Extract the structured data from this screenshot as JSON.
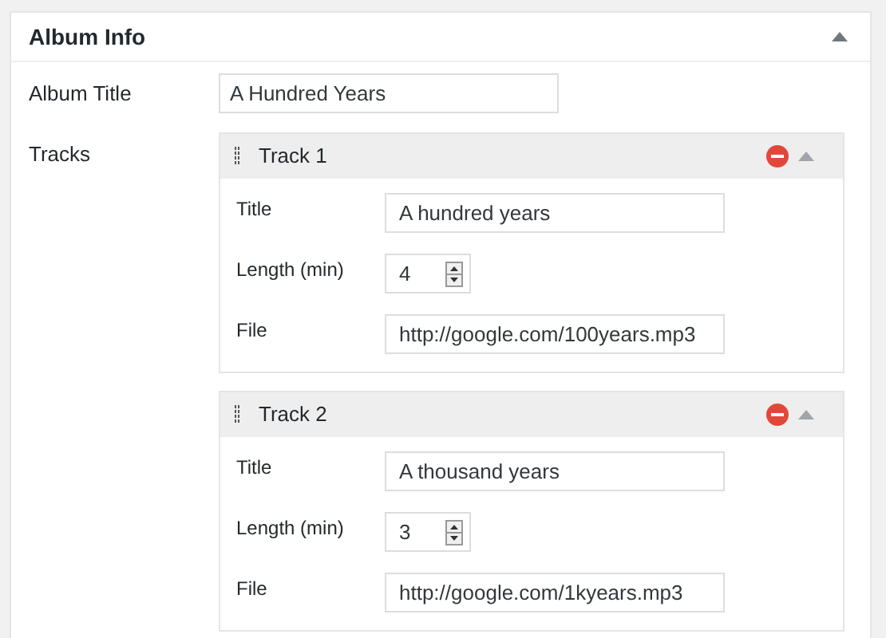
{
  "panel": {
    "title": "Album Info",
    "expanded": true
  },
  "album_title": {
    "label": "Album Title",
    "value": "A Hundred Years"
  },
  "tracks": {
    "label": "Tracks",
    "items": [
      {
        "title": "Track 1",
        "expanded": true,
        "fields": [
          {
            "kind": "text",
            "label": "Title",
            "value": "A hundred years"
          },
          {
            "kind": "number",
            "label": "Length (min)",
            "value": "4"
          },
          {
            "kind": "text",
            "label": "File",
            "value": "http://google.com/100years.mp3"
          }
        ]
      },
      {
        "title": "Track 2",
        "expanded": true,
        "fields": [
          {
            "kind": "text",
            "label": "Title",
            "value": "A thousand years"
          },
          {
            "kind": "number",
            "label": "Length (min)",
            "value": "3"
          },
          {
            "kind": "text",
            "label": "File",
            "value": "http://google.com/1kyears.mp3"
          }
        ]
      }
    ]
  }
}
